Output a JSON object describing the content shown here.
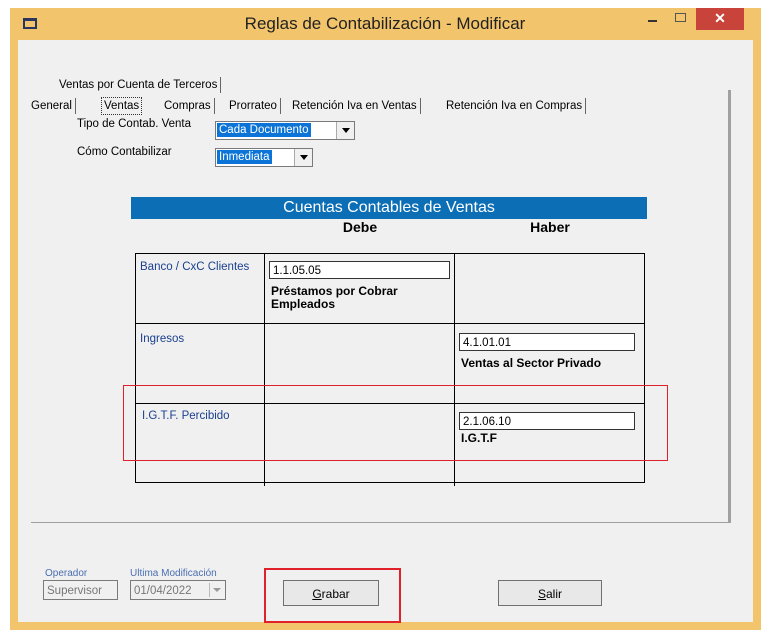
{
  "window": {
    "title": "Reglas de Contabilización - Modificar",
    "close_glyph": "✕"
  },
  "tabs": {
    "row1": [
      "Ventas por Cuenta de Terceros"
    ],
    "row2": [
      "General",
      "Ventas",
      "Compras",
      "Prorrateo",
      "Retención Iva en Ventas",
      "Retención Iva en Compras"
    ]
  },
  "form": {
    "tipo_label": "Tipo de Contab. Venta",
    "tipo_value": "Cada Documento",
    "como_label": "Cómo Contabilizar",
    "como_value": "Inmediata"
  },
  "table": {
    "title": "Cuentas Contables de Ventas",
    "col_debe": "Debe",
    "col_haber": "Haber",
    "rows": [
      {
        "label": "Banco / CxC Clientes",
        "debe_code": "1.1.05.05",
        "debe_desc_1": "Préstamos por Cobrar",
        "debe_desc_2": "Empleados"
      },
      {
        "label": "Ingresos",
        "haber_code": "4.1.01.01",
        "haber_desc": "Ventas al Sector Privado"
      },
      {
        "label": "I.G.T.F. Percibido",
        "haber_code": "2.1.06.10",
        "haber_desc": "I.G.T.F"
      }
    ]
  },
  "footer": {
    "operador_label": "Operador",
    "operador_value": "Supervisor",
    "ultima_label": "Ultima Modificación",
    "ultima_value": "01/04/2022",
    "grabar_hot": "G",
    "grabar_rest": "rabar",
    "salir_hot": "S",
    "salir_rest": "alir"
  },
  "colors": {
    "title_bar": "#f2c46b",
    "close": "#c8433a",
    "banner": "#0c6fb6",
    "highlight": "#e0202a"
  },
  "icons": [
    "app-icon",
    "minimize-icon",
    "maximize-icon",
    "close-icon",
    "dropdown-arrow-icon"
  ]
}
